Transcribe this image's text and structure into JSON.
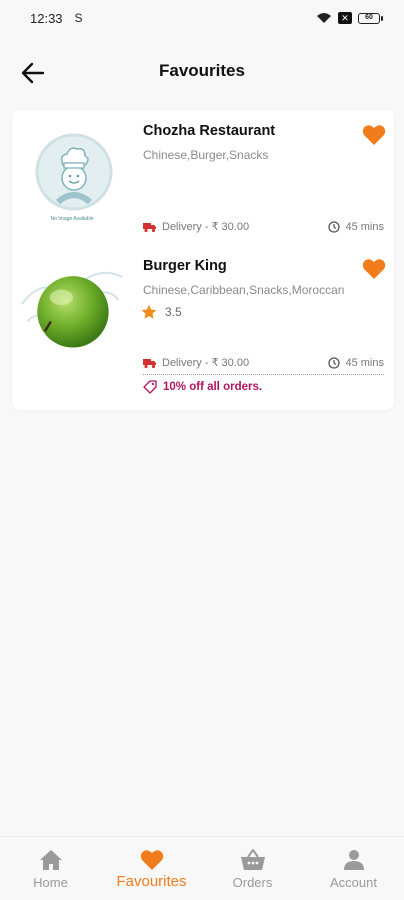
{
  "status_bar": {
    "time": "12:33",
    "sim_glyph": "S",
    "battery": "60"
  },
  "header": {
    "title": "Favourites"
  },
  "colors": {
    "accent": "#f07c1c",
    "offer": "#b0155e",
    "delivery_icon": "#d32f2f"
  },
  "favourites": [
    {
      "name": "Chozha Restaurant",
      "cuisines": "Chinese,Burger,Snacks",
      "image_caption": "No Image Available",
      "delivery": "Delivery - ₹ 30.00",
      "time": "45 mins"
    },
    {
      "name": "Burger King",
      "cuisines": "Chinese,Caribbean,Snacks,Moroccan",
      "rating": "3.5",
      "delivery": "Delivery - ₹ 30.00",
      "time": "45 mins",
      "offer": "10% off all orders."
    }
  ],
  "bottom_nav": [
    {
      "label": "Home",
      "icon": "home-icon"
    },
    {
      "label": "Favourites",
      "icon": "heart-icon",
      "active": true
    },
    {
      "label": "Orders",
      "icon": "basket-icon"
    },
    {
      "label": "Account",
      "icon": "person-icon"
    }
  ]
}
